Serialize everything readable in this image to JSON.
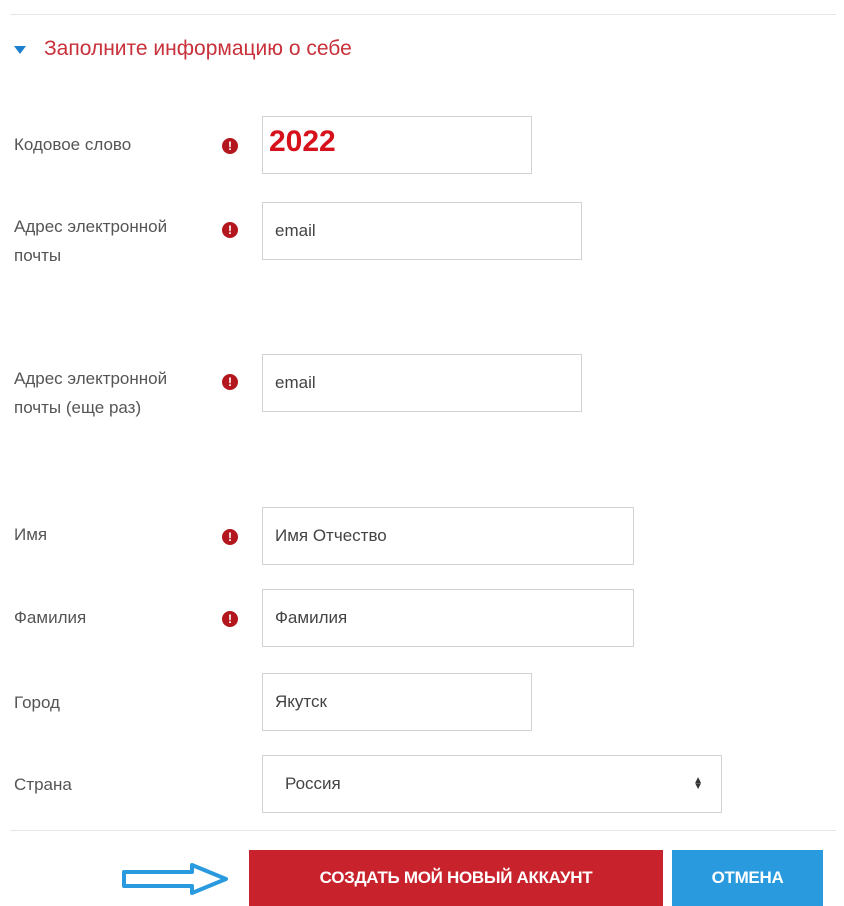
{
  "section": {
    "title": "Заполните информацию о себе"
  },
  "fields": [
    {
      "label": "Кодовое слово",
      "required": true,
      "value": "2022"
    },
    {
      "label": "Адрес электронной почты",
      "required": true,
      "value": "email"
    },
    {
      "label": "Адрес электронной почты (еще раз)",
      "required": true,
      "value": "email"
    },
    {
      "label": "Имя",
      "required": true,
      "value": "Имя Отчество"
    },
    {
      "label": "Фамилия",
      "required": true,
      "value": "Фамилия"
    },
    {
      "label": "Город",
      "required": false,
      "value": "Якутск"
    },
    {
      "label": "Страна",
      "required": false,
      "value": "Россия"
    }
  ],
  "required_mark": "!",
  "buttons": {
    "create": "СОЗДАТЬ МОЙ НОВЫЙ АККАУНТ",
    "cancel": "ОТМЕНА"
  },
  "colors": {
    "section_title": "#c8303a",
    "required_icon": "#b3161c",
    "primary_button": "#c8232d",
    "secondary_button": "#2a9adf",
    "arrow": "#2a9adf"
  },
  "icons": {
    "section_toggle": "caret-down-icon",
    "required": "exclamation-circle-icon",
    "select": "select-arrows-icon",
    "pointer": "right-arrow-icon"
  }
}
